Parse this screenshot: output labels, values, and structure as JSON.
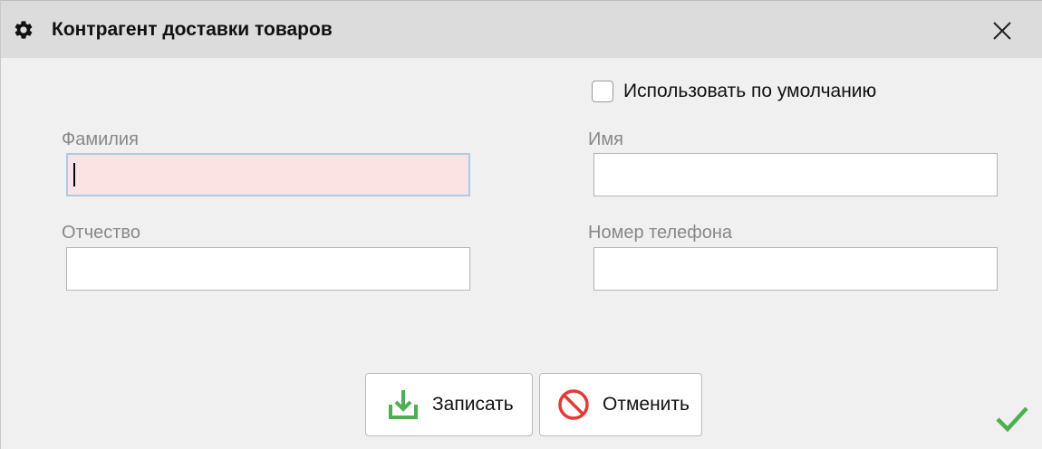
{
  "window": {
    "title": "Контрагент доставки товаров",
    "icon": "gear-icon",
    "close_icon": "close-icon"
  },
  "default_checkbox": {
    "label": "Использовать по умолчанию",
    "checked": false
  },
  "fields": {
    "last_name": {
      "label": "Фамилия",
      "value": ""
    },
    "first_name": {
      "label": "Имя",
      "value": ""
    },
    "patronymic": {
      "label": "Отчество",
      "value": ""
    },
    "phone": {
      "label": "Номер телефона",
      "value": ""
    }
  },
  "buttons": {
    "save": {
      "label": "Записать",
      "icon": "download-icon"
    },
    "cancel": {
      "label": "Отменить",
      "icon": "cancel-icon"
    }
  },
  "colors": {
    "required_field_bg": "#fbe3e3",
    "focus_border": "#aec9ea",
    "save_icon": "#4caf50",
    "cancel_icon": "#e53935",
    "ok_check": "#4caf50"
  }
}
